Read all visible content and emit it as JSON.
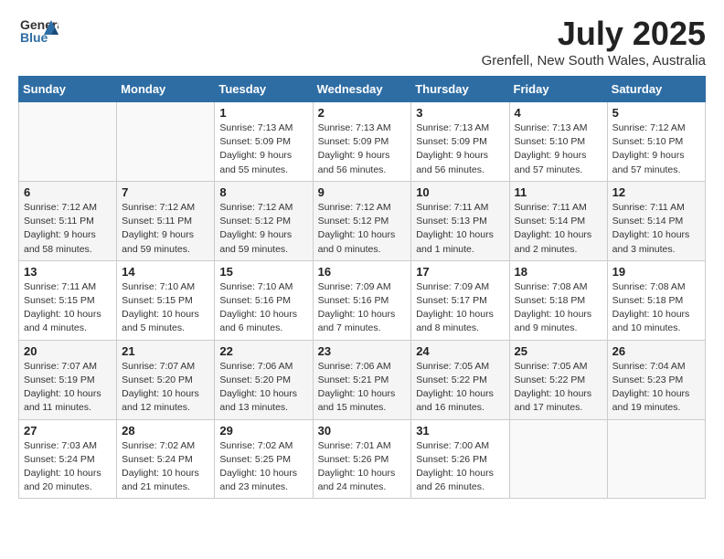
{
  "header": {
    "logo_general": "General",
    "logo_blue": "Blue",
    "month_title": "July 2025",
    "location": "Grenfell, New South Wales, Australia"
  },
  "days_of_week": [
    "Sunday",
    "Monday",
    "Tuesday",
    "Wednesday",
    "Thursday",
    "Friday",
    "Saturday"
  ],
  "weeks": [
    [
      {
        "day": "",
        "info": ""
      },
      {
        "day": "",
        "info": ""
      },
      {
        "day": "1",
        "info": "Sunrise: 7:13 AM\nSunset: 5:09 PM\nDaylight: 9 hours and 55 minutes."
      },
      {
        "day": "2",
        "info": "Sunrise: 7:13 AM\nSunset: 5:09 PM\nDaylight: 9 hours and 56 minutes."
      },
      {
        "day": "3",
        "info": "Sunrise: 7:13 AM\nSunset: 5:09 PM\nDaylight: 9 hours and 56 minutes."
      },
      {
        "day": "4",
        "info": "Sunrise: 7:13 AM\nSunset: 5:10 PM\nDaylight: 9 hours and 57 minutes."
      },
      {
        "day": "5",
        "info": "Sunrise: 7:12 AM\nSunset: 5:10 PM\nDaylight: 9 hours and 57 minutes."
      }
    ],
    [
      {
        "day": "6",
        "info": "Sunrise: 7:12 AM\nSunset: 5:11 PM\nDaylight: 9 hours and 58 minutes."
      },
      {
        "day": "7",
        "info": "Sunrise: 7:12 AM\nSunset: 5:11 PM\nDaylight: 9 hours and 59 minutes."
      },
      {
        "day": "8",
        "info": "Sunrise: 7:12 AM\nSunset: 5:12 PM\nDaylight: 9 hours and 59 minutes."
      },
      {
        "day": "9",
        "info": "Sunrise: 7:12 AM\nSunset: 5:12 PM\nDaylight: 10 hours and 0 minutes."
      },
      {
        "day": "10",
        "info": "Sunrise: 7:11 AM\nSunset: 5:13 PM\nDaylight: 10 hours and 1 minute."
      },
      {
        "day": "11",
        "info": "Sunrise: 7:11 AM\nSunset: 5:14 PM\nDaylight: 10 hours and 2 minutes."
      },
      {
        "day": "12",
        "info": "Sunrise: 7:11 AM\nSunset: 5:14 PM\nDaylight: 10 hours and 3 minutes."
      }
    ],
    [
      {
        "day": "13",
        "info": "Sunrise: 7:11 AM\nSunset: 5:15 PM\nDaylight: 10 hours and 4 minutes."
      },
      {
        "day": "14",
        "info": "Sunrise: 7:10 AM\nSunset: 5:15 PM\nDaylight: 10 hours and 5 minutes."
      },
      {
        "day": "15",
        "info": "Sunrise: 7:10 AM\nSunset: 5:16 PM\nDaylight: 10 hours and 6 minutes."
      },
      {
        "day": "16",
        "info": "Sunrise: 7:09 AM\nSunset: 5:16 PM\nDaylight: 10 hours and 7 minutes."
      },
      {
        "day": "17",
        "info": "Sunrise: 7:09 AM\nSunset: 5:17 PM\nDaylight: 10 hours and 8 minutes."
      },
      {
        "day": "18",
        "info": "Sunrise: 7:08 AM\nSunset: 5:18 PM\nDaylight: 10 hours and 9 minutes."
      },
      {
        "day": "19",
        "info": "Sunrise: 7:08 AM\nSunset: 5:18 PM\nDaylight: 10 hours and 10 minutes."
      }
    ],
    [
      {
        "day": "20",
        "info": "Sunrise: 7:07 AM\nSunset: 5:19 PM\nDaylight: 10 hours and 11 minutes."
      },
      {
        "day": "21",
        "info": "Sunrise: 7:07 AM\nSunset: 5:20 PM\nDaylight: 10 hours and 12 minutes."
      },
      {
        "day": "22",
        "info": "Sunrise: 7:06 AM\nSunset: 5:20 PM\nDaylight: 10 hours and 13 minutes."
      },
      {
        "day": "23",
        "info": "Sunrise: 7:06 AM\nSunset: 5:21 PM\nDaylight: 10 hours and 15 minutes."
      },
      {
        "day": "24",
        "info": "Sunrise: 7:05 AM\nSunset: 5:22 PM\nDaylight: 10 hours and 16 minutes."
      },
      {
        "day": "25",
        "info": "Sunrise: 7:05 AM\nSunset: 5:22 PM\nDaylight: 10 hours and 17 minutes."
      },
      {
        "day": "26",
        "info": "Sunrise: 7:04 AM\nSunset: 5:23 PM\nDaylight: 10 hours and 19 minutes."
      }
    ],
    [
      {
        "day": "27",
        "info": "Sunrise: 7:03 AM\nSunset: 5:24 PM\nDaylight: 10 hours and 20 minutes."
      },
      {
        "day": "28",
        "info": "Sunrise: 7:02 AM\nSunset: 5:24 PM\nDaylight: 10 hours and 21 minutes."
      },
      {
        "day": "29",
        "info": "Sunrise: 7:02 AM\nSunset: 5:25 PM\nDaylight: 10 hours and 23 minutes."
      },
      {
        "day": "30",
        "info": "Sunrise: 7:01 AM\nSunset: 5:26 PM\nDaylight: 10 hours and 24 minutes."
      },
      {
        "day": "31",
        "info": "Sunrise: 7:00 AM\nSunset: 5:26 PM\nDaylight: 10 hours and 26 minutes."
      },
      {
        "day": "",
        "info": ""
      },
      {
        "day": "",
        "info": ""
      }
    ]
  ]
}
